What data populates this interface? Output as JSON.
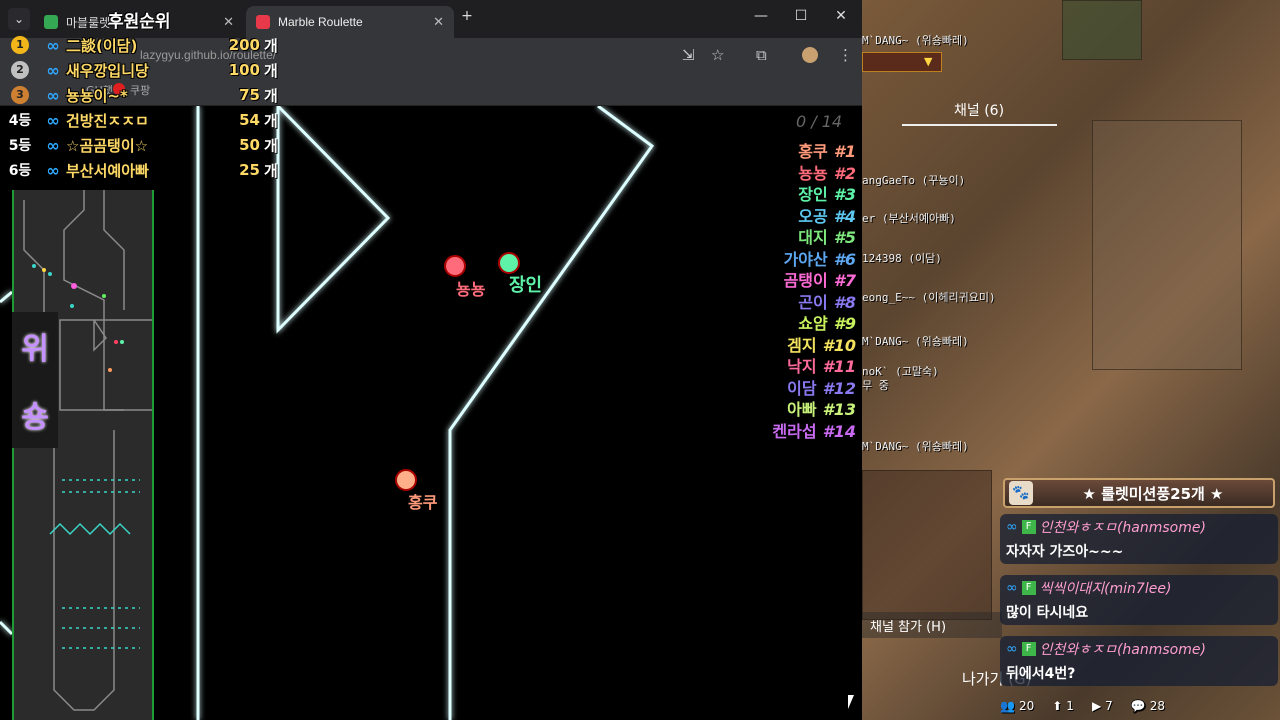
{
  "browser": {
    "tabs": [
      {
        "label": "마블룰렛",
        "fav_color": "#34a853"
      },
      {
        "label": "Marble Roulette",
        "fav_color": "#e8394b"
      }
    ],
    "new_tab": "+",
    "url": "lazygyu.github.io/roulette/",
    "bookmarks": [
      "GH챗",
      "쿠팡"
    ],
    "window": {
      "minimize": "—",
      "maximize": "☐",
      "close": "✕"
    }
  },
  "ranking": {
    "title": "후원순위",
    "unit": "개",
    "rows": [
      {
        "pos": "1",
        "name": "二談(이담)",
        "count": "200",
        "medal": "#f2b61b"
      },
      {
        "pos": "2",
        "name": "새우깡입니당",
        "count": "100",
        "medal": "#c0c0c0"
      },
      {
        "pos": "3",
        "name": "뇽뇽이~*",
        "count": "75",
        "medal": "#cd7f32"
      },
      {
        "pos": "4등",
        "name": "건방진ㅈㅈㅁ",
        "count": "54"
      },
      {
        "pos": "5등",
        "name": "☆곰곰탱이☆",
        "count": "50"
      },
      {
        "pos": "6등",
        "name": "부산서예아빠",
        "count": "25"
      }
    ]
  },
  "game": {
    "counter": "0 / 14",
    "results": [
      {
        "name": "홍쿠",
        "rank": "#1",
        "color": "#ff9a7a"
      },
      {
        "name": "뇽뇽",
        "rank": "#2",
        "color": "#ff6b7a"
      },
      {
        "name": "장인",
        "rank": "#3",
        "color": "#5ef2a8"
      },
      {
        "name": "오공",
        "rank": "#4",
        "color": "#5ec8f2"
      },
      {
        "name": "대지",
        "rank": "#5",
        "color": "#7ee87e"
      },
      {
        "name": "가야산",
        "rank": "#6",
        "color": "#5ea8f2"
      },
      {
        "name": "곰탱이",
        "rank": "#7",
        "color": "#ff6bd6"
      },
      {
        "name": "곤이",
        "rank": "#8",
        "color": "#8a7af2"
      },
      {
        "name": "쇼얌",
        "rank": "#9",
        "color": "#c8f25e"
      },
      {
        "name": "겜지",
        "rank": "#10",
        "color": "#f2e25e"
      },
      {
        "name": "낙지",
        "rank": "#11",
        "color": "#ff6b9a"
      },
      {
        "name": "이담",
        "rank": "#12",
        "color": "#8a7af2"
      },
      {
        "name": "아빠",
        "rank": "#13",
        "color": "#c8f27a"
      },
      {
        "name": "켄라섭",
        "rank": "#14",
        "color": "#c86bf2"
      }
    ],
    "marbles": [
      {
        "label": "뇽뇽",
        "color": "#ff6b7a"
      },
      {
        "label": "장인",
        "color": "#5ef2a8"
      },
      {
        "label": "홍쿠",
        "color": "#ff9a7a"
      }
    ],
    "side_label": [
      "위",
      "숑"
    ]
  },
  "chat": {
    "channel_tab": "채널 (6)",
    "lines": [
      "M`DANG~ (위숑빠레)",
      "angGaeTo (꾸뇽이)",
      "er (부산서예아빠)",
      "124398 (이담)",
      "eong_E~~ (이헤리귀요미)",
      "M`DANG~ (위숑빠레)",
      "noK` (고말숙)",
      "무 중",
      "M`DANG~ (위숑빠레)"
    ],
    "join_channel": "채널 참가 (H)",
    "leave": "나가기 (G)",
    "donate_title": "★ 룰렛미션풍25개 ★",
    "messages": [
      {
        "user": "인천와ㅎㅈㅁ(hanmsome)",
        "text": "자자자 가즈아~~~",
        "color": "#ff9ed0"
      },
      {
        "user": "씩씩이대지(min7lee)",
        "text": "많이 타시네요",
        "color": "#ff9ed0"
      },
      {
        "user": "인천와ㅎㅈㅁ(hanmsome)",
        "text": "뒤에서4번?",
        "color": "#ff9ed0"
      }
    ],
    "stats": [
      {
        "icon": "👥",
        "value": "20"
      },
      {
        "icon": "⬆",
        "value": "1"
      },
      {
        "icon": "▶",
        "value": "7"
      },
      {
        "icon": "💬",
        "value": "28"
      }
    ]
  }
}
